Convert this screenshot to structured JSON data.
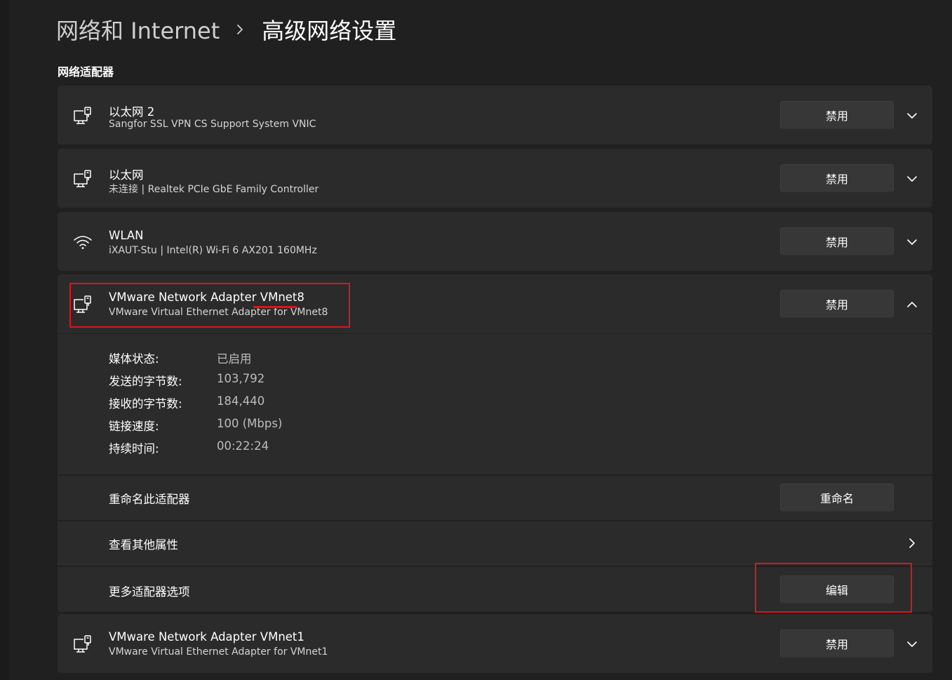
{
  "breadcrumb": {
    "parent": "网络和 Internet",
    "current": "高级网络设置"
  },
  "section_title": "网络适配器",
  "adapters": [
    {
      "name": "以太网 2",
      "description": "Sangfor SSL VPN CS Support System VNIC",
      "icon": "ethernet-icon",
      "button": "禁用",
      "expanded": false
    },
    {
      "name": "以太网",
      "description": "未连接 | Realtek PCIe GbE Family Controller",
      "icon": "ethernet-icon",
      "button": "禁用",
      "expanded": false
    },
    {
      "name": "WLAN",
      "description": "iXAUT-Stu | Intel(R) Wi-Fi 6 AX201 160MHz",
      "icon": "wifi-icon",
      "button": "禁用",
      "expanded": false
    },
    {
      "name": "VMware Network Adapter VMnet8",
      "description": "VMware Virtual Ethernet Adapter for VMnet8",
      "icon": "ethernet-icon",
      "button": "禁用",
      "expanded": true
    },
    {
      "name": "VMware Network Adapter VMnet1",
      "description": "VMware Virtual Ethernet Adapter for VMnet1",
      "icon": "ethernet-icon",
      "button": "禁用",
      "expanded": false
    }
  ],
  "details": [
    {
      "label": "媒体状态:",
      "value": "已启用"
    },
    {
      "label": "发送的字节数:",
      "value": "103,792"
    },
    {
      "label": "接收的字节数:",
      "value": "184,440"
    },
    {
      "label": "链接速度:",
      "value": "100 (Mbps)"
    },
    {
      "label": "持续时间:",
      "value": "00:22:24"
    }
  ],
  "actions": {
    "rename": {
      "label": "重命名此适配器",
      "button": "重命名"
    },
    "properties": {
      "label": "查看其他属性"
    },
    "more_options": {
      "label": "更多适配器选项",
      "button": "编辑"
    }
  },
  "colors": {
    "background": "#202020",
    "card": "#2b2b2b",
    "button": "#373737",
    "annotation": "#e2121b"
  }
}
